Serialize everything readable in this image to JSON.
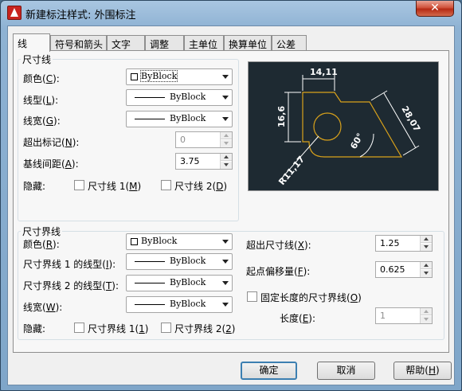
{
  "window": {
    "title": "新建标注样式: 外围标注",
    "close_glyph": "✕"
  },
  "tabs": [
    "线",
    "符号和箭头",
    "文字",
    "调整",
    "主单位",
    "换算单位",
    "公差"
  ],
  "dim_lines": {
    "legend": "尺寸线",
    "color": {
      "label": "颜色",
      "key": "C",
      "value": "ByBlock"
    },
    "linetype": {
      "label": "线型",
      "key": "L",
      "value": "ByBlock"
    },
    "lineweight": {
      "label": "线宽",
      "key": "G",
      "value": "ByBlock"
    },
    "extend_ticks": {
      "label": "超出标记",
      "key": "N",
      "value": "0"
    },
    "baseline_spacing": {
      "label": "基线间距",
      "key": "A",
      "value": "3.75"
    },
    "suppress": {
      "label": "隐藏:",
      "dim_line1": "尺寸线 1",
      "key1": "M",
      "dim_line2": "尺寸线 2",
      "key2": "D"
    }
  },
  "ext_lines": {
    "legend": "尺寸界线",
    "color": {
      "label": "颜色",
      "key": "R",
      "value": "ByBlock"
    },
    "linetype1": {
      "label": "尺寸界线 1 的线型",
      "key": "I",
      "value": "ByBlock"
    },
    "linetype2": {
      "label": "尺寸界线 2 的线型",
      "key": "T",
      "value": "ByBlock"
    },
    "lineweight": {
      "label": "线宽",
      "key": "W",
      "value": "ByBlock"
    },
    "suppress": {
      "label": "隐藏:",
      "ext_line1": "尺寸界线 1",
      "key1": "1",
      "ext_line2": "尺寸界线 2",
      "key2": "2"
    },
    "extend_beyond": {
      "label": "超出尺寸线",
      "key": "X",
      "value": "1.25"
    },
    "offset_origin": {
      "label": "起点偏移量",
      "key": "F",
      "value": "0.625"
    },
    "fixed_length": {
      "label": "固定长度的尺寸界线",
      "key": "O",
      "checked": false
    },
    "length": {
      "label": "长度",
      "key": "E",
      "value": "1"
    }
  },
  "preview": {
    "dim_top": "14,11",
    "dim_left": "16,6",
    "dim_right": "28,07",
    "dim_angle": "60°",
    "dim_radius": "R11,17",
    "colors": {
      "background": "#1e2a32",
      "geometry": "#d9a21b",
      "dimension": "#ffffff"
    }
  },
  "buttons": {
    "ok": "确定",
    "cancel": "取消",
    "help": "帮助",
    "help_key": "H"
  }
}
